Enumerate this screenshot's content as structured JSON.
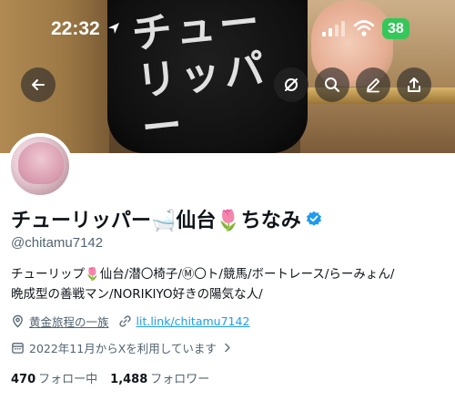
{
  "status_bar": {
    "time": "22:32",
    "battery": "38"
  },
  "banner": {
    "shirt_text": "チューリッパー"
  },
  "header_actions": {
    "back": "arrow-left-icon",
    "mute": "mute-icon",
    "search": "search-icon",
    "edit": "pencil-icon",
    "share": "share-icon"
  },
  "profile": {
    "display_name": "チューリッパー🛁仙台🌷ちなみ",
    "handle": "@chitamu7142",
    "bio_line1": "チューリップ🌷仙台/潜〇椅子/Ⓜ〇ト/競馬/ボートレース/らーみょん/",
    "bio_line2": "晩成型の善戦マン/NORIKIYO好きの陽気な人/",
    "location": "黄金旅程の一族",
    "link": "lit.link/chitamu7142",
    "joined": "2022年11月からXを利用しています",
    "following_count": "470",
    "following_label": "フォロー中",
    "followers_count": "1,488",
    "followers_label": "フォロワー"
  },
  "colors": {
    "accent": "#1d9bf0",
    "secondary_text": "#536471",
    "primary_text": "#0f1419",
    "battery": "#35c759"
  }
}
